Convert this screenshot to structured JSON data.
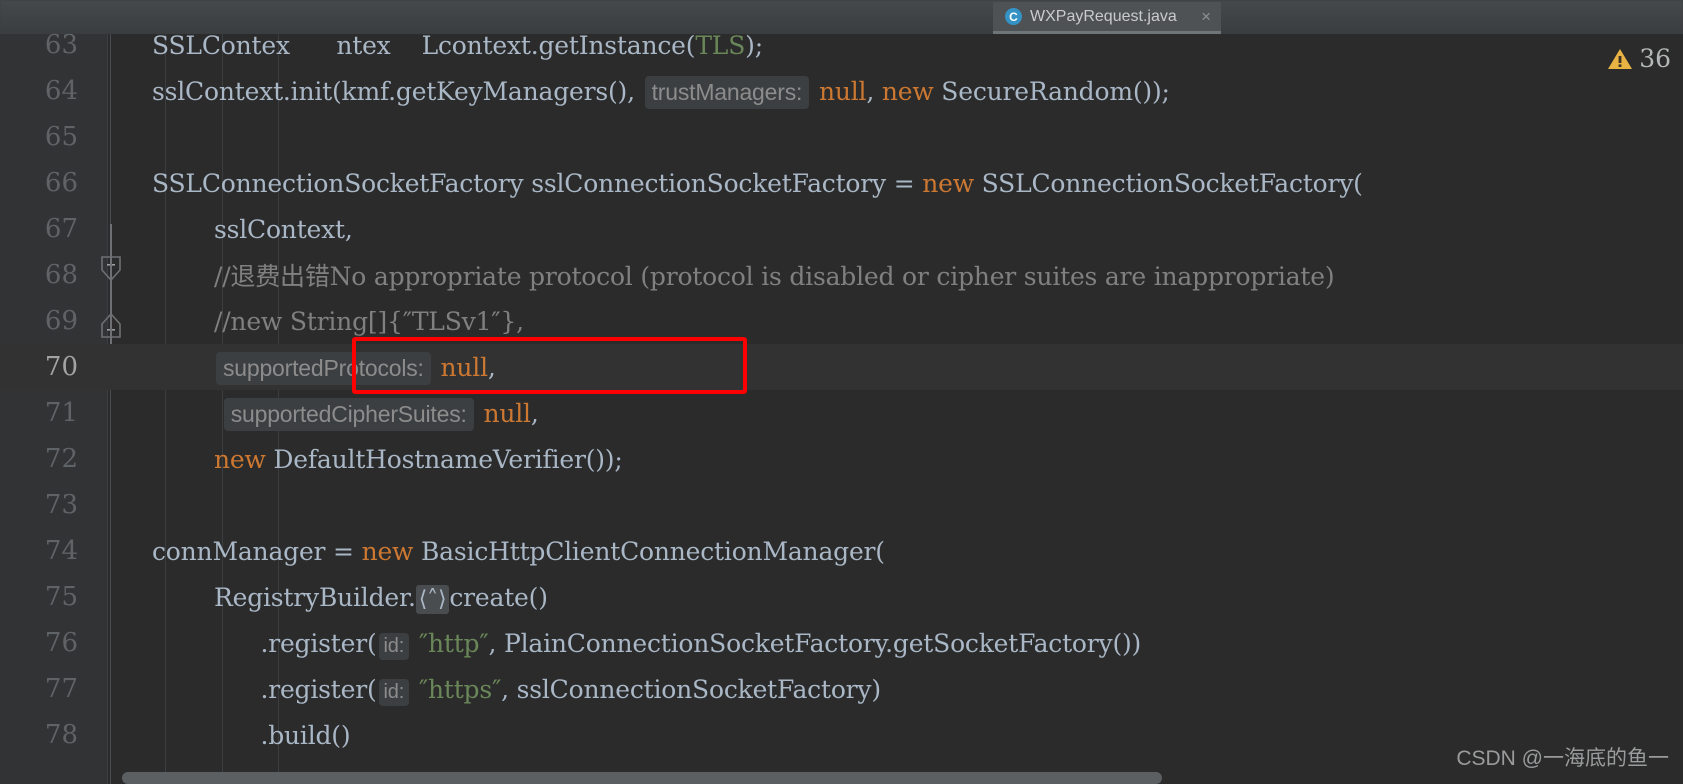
{
  "window": {
    "warning_icon": "warning-triangle-icon",
    "warning_count": "36",
    "warning_color": "#e8b342"
  },
  "tabs": {
    "active": {
      "icon": "java-class-icon",
      "icon_letter": "C",
      "label": "WXPayRequest.java",
      "close_label": "×"
    }
  },
  "editor": {
    "current_line_number": "70",
    "gutter": {
      "fold_marker_icons": [
        "fold-collapse-icon",
        "fold-collapse-icon"
      ],
      "intention_icon": "lightbulb-icon"
    },
    "lines": [
      {
        "no": "63",
        "segments": [
          {
            "t": "SSLConte",
            "c": "ident"
          },
          {
            "t": "x      ",
            "c": "ident"
          },
          {
            "t": "ntex",
            "c": "ident"
          },
          {
            "t": "    ",
            "c": "ident"
          },
          {
            "t": "Lcontext.getInstance(",
            "c": "ident"
          },
          {
            "t": "TLS",
            "c": "str"
          },
          {
            "t": ");",
            "c": "ident"
          }
        ]
      },
      {
        "no": "64",
        "segments": [
          {
            "t": "sslContext.init(kmf.getKeyManagers(), ",
            "c": "ident"
          },
          {
            "t": "trustManagers:",
            "c": "hint"
          },
          {
            "t": " ",
            "c": "ident"
          },
          {
            "t": "null",
            "c": "kw"
          },
          {
            "t": ", ",
            "c": "ident"
          },
          {
            "t": "new",
            "c": "kw"
          },
          {
            "t": " SecureRandom());",
            "c": "ident"
          }
        ]
      },
      {
        "no": "65",
        "segments": []
      },
      {
        "no": "66",
        "segments": [
          {
            "t": "SSLConnectionSocketFactory sslConnectionSocketFactory = ",
            "c": "ident"
          },
          {
            "t": "new",
            "c": "kw"
          },
          {
            "t": " SSLConnectionSocketFactory(",
            "c": "ident"
          }
        ]
      },
      {
        "no": "67",
        "segments": [
          {
            "t": "        sslContext,",
            "c": "ident"
          }
        ]
      },
      {
        "no": "68",
        "segments": [
          {
            "t": "        //退费出错No appropriate protocol (protocol is disabled or cipher suites are inappropriate)",
            "c": "cmt"
          }
        ]
      },
      {
        "no": "69",
        "segments": [
          {
            "t": "        //new String[]{″TLSv1″},",
            "c": "cmt"
          }
        ]
      },
      {
        "no": "70",
        "segments": [
          {
            "t": "        ",
            "c": "ident"
          },
          {
            "t": "supportedProtocols:",
            "c": "hint"
          },
          {
            "t": " ",
            "c": "ident"
          },
          {
            "t": "null",
            "c": "kw"
          },
          {
            "t": ",",
            "c": "ident"
          }
        ]
      },
      {
        "no": "71",
        "segments": [
          {
            "t": "         ",
            "c": "ident"
          },
          {
            "t": "supportedCipherSuites:",
            "c": "hint"
          },
          {
            "t": " ",
            "c": "ident"
          },
          {
            "t": "null",
            "c": "kw"
          },
          {
            "t": ",",
            "c": "ident"
          }
        ]
      },
      {
        "no": "72",
        "segments": [
          {
            "t": "        ",
            "c": "ident"
          },
          {
            "t": "new",
            "c": "kw"
          },
          {
            "t": " DefaultHostnameVerifier());",
            "c": "ident"
          }
        ]
      },
      {
        "no": "73",
        "segments": []
      },
      {
        "no": "74",
        "segments": [
          {
            "t": "connManager = ",
            "c": "ident"
          },
          {
            "t": "new",
            "c": "kw"
          },
          {
            "t": " BasicHttpClientConnectionManager(",
            "c": "ident"
          }
        ]
      },
      {
        "no": "75",
        "segments": [
          {
            "t": "        RegistryBuilder.",
            "c": "ident"
          },
          {
            "t": "⟨˄⟩",
            "c": "fold"
          },
          {
            "t": "create()",
            "c": "ident"
          }
        ]
      },
      {
        "no": "76",
        "segments": [
          {
            "t": "              .register(",
            "c": "ident"
          },
          {
            "t": "id:",
            "c": "hintsm"
          },
          {
            "t": " ",
            "c": "ident"
          },
          {
            "t": "″http″",
            "c": "str"
          },
          {
            "t": ", PlainConnectionSocketFactory.getSocketFactory())",
            "c": "ident"
          }
        ]
      },
      {
        "no": "77",
        "segments": [
          {
            "t": "              .register(",
            "c": "ident"
          },
          {
            "t": "id:",
            "c": "hintsm"
          },
          {
            "t": " ",
            "c": "ident"
          },
          {
            "t": "″https″",
            "c": "str"
          },
          {
            "t": ", sslConnectionSocketFactory)",
            "c": "ident"
          }
        ]
      },
      {
        "no": "78",
        "segments": [
          {
            "t": "              .build()",
            "c": "ident"
          }
        ]
      }
    ]
  },
  "annotation": {
    "type": "red-rectangle-highlight",
    "color": "#fe0000",
    "target_text": "supportedProtocols: null,"
  },
  "watermark": {
    "text": "CSDN @一海底的鱼一"
  }
}
